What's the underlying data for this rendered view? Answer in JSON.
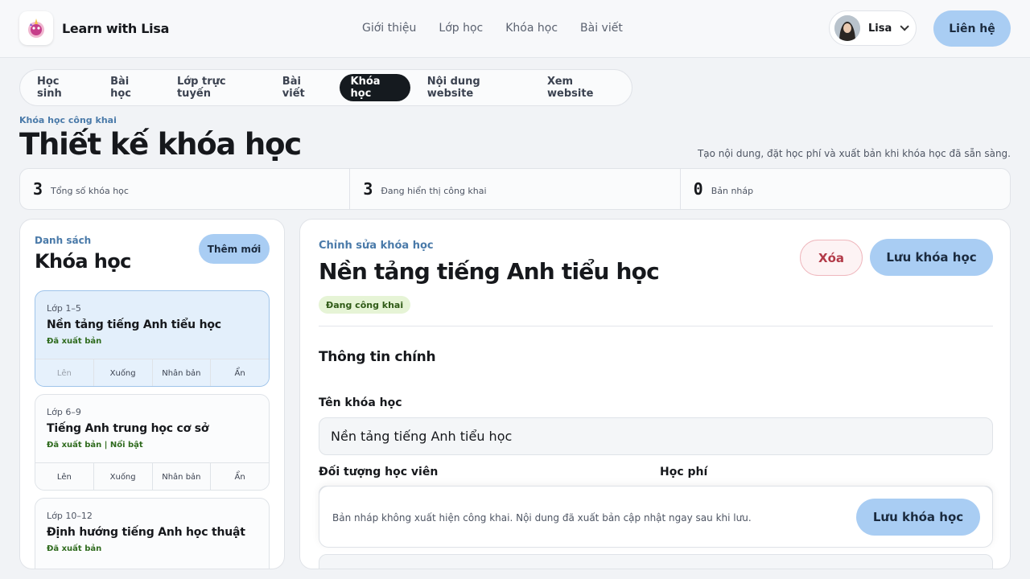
{
  "header": {
    "brand": "Learn with Lisa",
    "nav": [
      "Giới thiệu",
      "Lớp học",
      "Khóa học",
      "Bài viết"
    ],
    "user_name": "Lisa",
    "contact_label": "Liên hệ"
  },
  "tabs": [
    {
      "label": "Học sinh",
      "active": false
    },
    {
      "label": "Bài học",
      "active": false
    },
    {
      "label": "Lớp trực tuyến",
      "active": false
    },
    {
      "label": "Bài viết",
      "active": false
    },
    {
      "label": "Khóa học",
      "active": true
    },
    {
      "label": "Nội dung website",
      "active": false
    },
    {
      "label": "Xem website",
      "active": false
    }
  ],
  "page": {
    "eyebrow": "Khóa học công khai",
    "title": "Thiết kế khóa học",
    "subtitle": "Tạo nội dung, đặt học phí và xuất bản khi khóa học đã sẵn sàng."
  },
  "stats": [
    {
      "value": "3",
      "label": "Tổng số khóa học"
    },
    {
      "value": "3",
      "label": "Đang hiển thị công khai"
    },
    {
      "value": "0",
      "label": "Bản nháp"
    }
  ],
  "list": {
    "eyebrow": "Danh sách",
    "title": "Khóa học",
    "add_label": "Thêm mới",
    "actions": [
      "Lên",
      "Xuống",
      "Nhân bản",
      "Ẩn"
    ],
    "courses": [
      {
        "grade": "Lớp 1–5",
        "title": "Nền tảng tiếng Anh tiểu học",
        "status": "Đã xuất bản"
      },
      {
        "grade": "Lớp 6–9",
        "title": "Tiếng Anh trung học cơ sở",
        "status": "Đã xuất bản | Nổi bật"
      },
      {
        "grade": "Lớp 10–12",
        "title": "Định hướng tiếng Anh học thuật",
        "status": "Đã xuất bản"
      }
    ]
  },
  "editor": {
    "eyebrow": "Chỉnh sửa khóa học",
    "title": "Nền tảng tiếng Anh tiểu học",
    "badge": "Đang công khai",
    "delete_label": "Xóa",
    "save_label": "Lưu khóa học",
    "section_title": "Thông tin chính",
    "name_label": "Tên khóa học",
    "name_value": "Nền tảng tiếng Anh tiểu học",
    "audience_label": "Đối tượng học viên",
    "fee_label": "Học phí",
    "footer_text": "Bản nháp không xuất hiện công khai. Nội dung đã xuất bản cập nhật ngay sau khi lưu.",
    "footer_save_label": "Lưu khóa học"
  },
  "colors": {
    "accent": "#a9cdf3",
    "eyebrow": "#4a7aa9",
    "published": "#2f6b1e",
    "danger": "#b23a48"
  }
}
